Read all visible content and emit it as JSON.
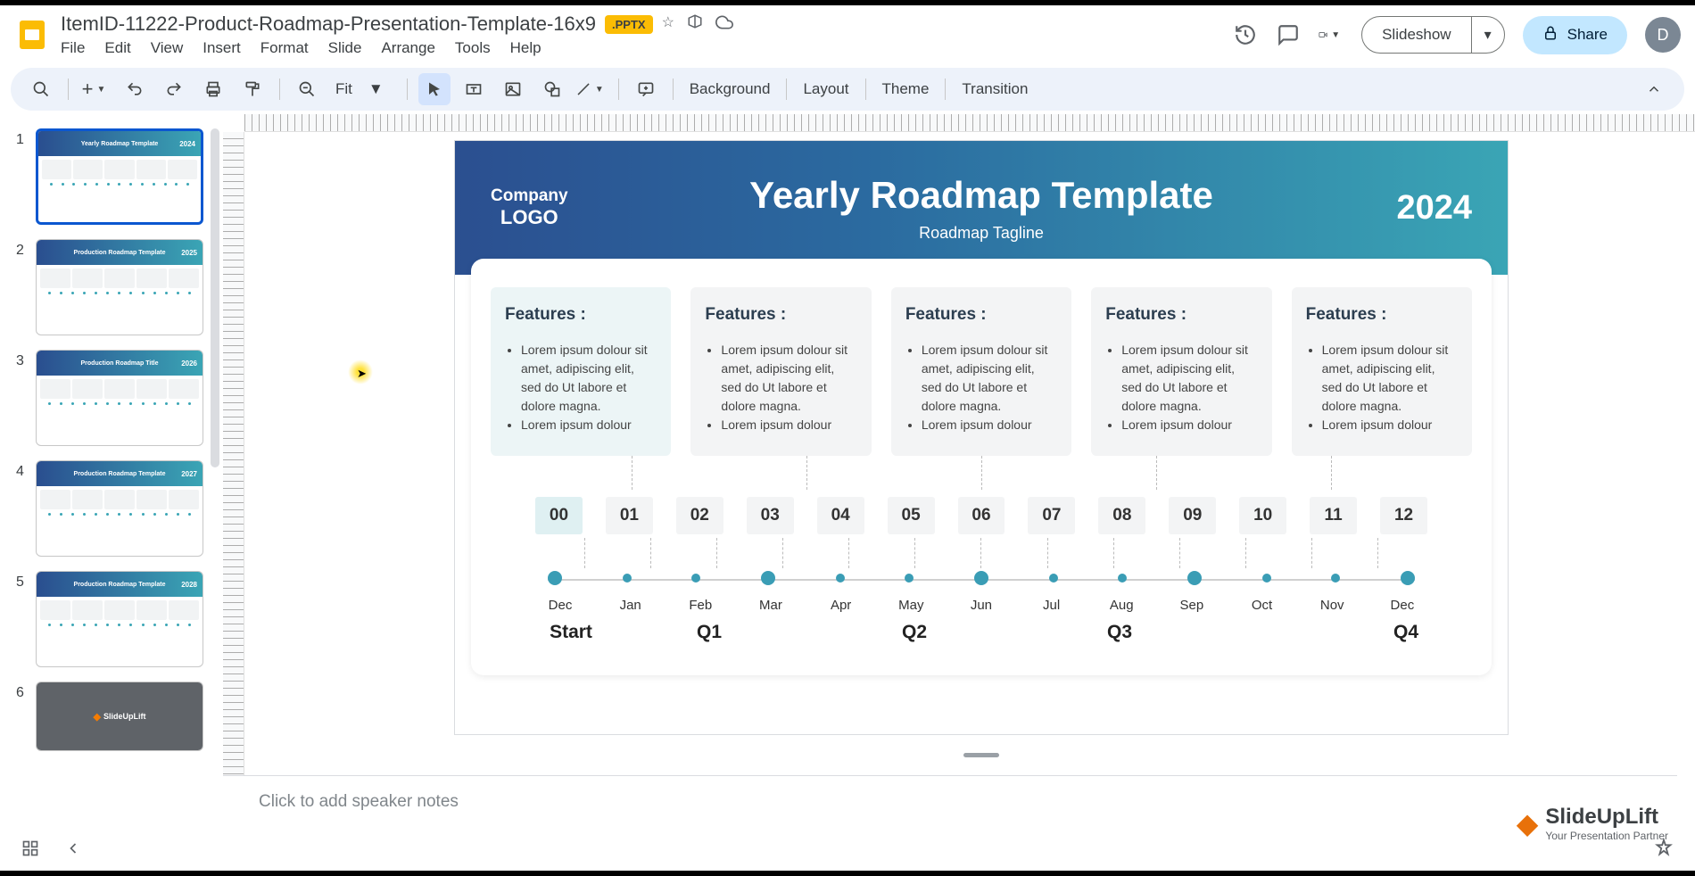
{
  "doc": {
    "title": "ItemID-11222-Product-Roadmap-Presentation-Template-16x9",
    "badge": ".PPTX"
  },
  "menu": {
    "file": "File",
    "edit": "Edit",
    "view": "View",
    "insert": "Insert",
    "format": "Format",
    "slide": "Slide",
    "arrange": "Arrange",
    "tools": "Tools",
    "help": "Help"
  },
  "header_buttons": {
    "slideshow": "Slideshow",
    "share": "Share",
    "avatar_initial": "D"
  },
  "toolbar": {
    "zoom": "Fit",
    "background": "Background",
    "layout": "Layout",
    "theme": "Theme",
    "transition": "Transition"
  },
  "thumbs": {
    "nums": [
      "1",
      "2",
      "3",
      "4",
      "5",
      "6"
    ],
    "titles": [
      "Yearly Roadmap Template",
      "Production Roadmap Template",
      "Production Roadmap Title",
      "Production Roadmap Template",
      "Production Roadmap Template",
      ""
    ],
    "years": [
      "2024",
      "2025",
      "2026",
      "2027",
      "2028",
      ""
    ]
  },
  "slide": {
    "logo": {
      "l1": "Company",
      "l2": "LOGO"
    },
    "title": "Yearly Roadmap Template",
    "tagline": "Roadmap Tagline",
    "year": "2024",
    "feature_title": "Features :",
    "feature_bullets": [
      "Lorem ipsum dolour sit amet, adipiscing elit, sed do Ut labore et dolore magna.",
      "Lorem ipsum dolour"
    ],
    "timeline_nums": [
      "00",
      "01",
      "02",
      "03",
      "04",
      "05",
      "06",
      "07",
      "08",
      "09",
      "10",
      "11",
      "12"
    ],
    "months": [
      "Dec",
      "Jan",
      "Feb",
      "Mar",
      "Apr",
      "May",
      "Jun",
      "Jul",
      "Aug",
      "Sep",
      "Oct",
      "Nov",
      "Dec"
    ],
    "quarters": [
      "Start",
      "Q1",
      "Q2",
      "Q3",
      "Q4"
    ]
  },
  "notes_placeholder": "Click to add speaker notes",
  "brand": {
    "name": "SlideUpLift",
    "sub": "Your Presentation Partner"
  }
}
